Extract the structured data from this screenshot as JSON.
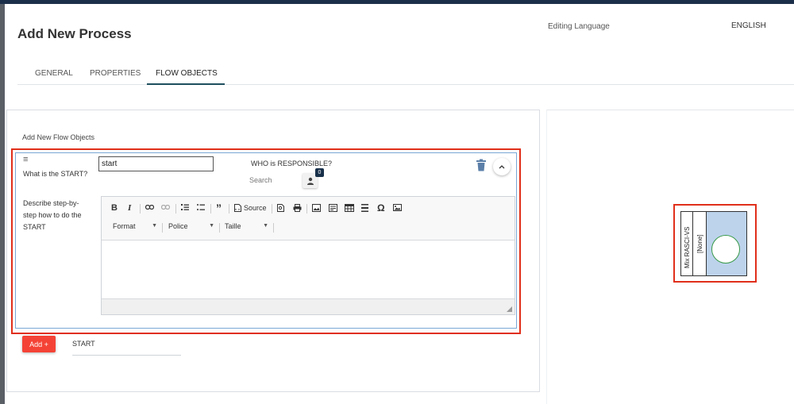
{
  "page": {
    "title": "Add New Process"
  },
  "language": {
    "label": "Editing Language",
    "value": "ENGLISH"
  },
  "tabs": [
    {
      "label": "GENERAL",
      "active": false
    },
    {
      "label": "PROPERTIES",
      "active": false
    },
    {
      "label": "FLOW OBJECTS",
      "active": true
    }
  ],
  "section": {
    "title": "Add New Flow Objects"
  },
  "flow_object": {
    "question_label": "What is the START?",
    "input_value": "start",
    "responsible_label": "WHO is RESPONSIBLE?",
    "search_placeholder": "Search",
    "responsible_count": "0",
    "describe_label": "Describe step-by-step how to do the START",
    "collapse_icon": "chevron-up-icon",
    "delete_icon": "trash-icon"
  },
  "editor": {
    "source_label": "Source",
    "format_label": "Format",
    "font_label": "Police",
    "size_label": "Taille"
  },
  "add": {
    "button_label": "Add +",
    "field_value": "START"
  },
  "diagram": {
    "lane_label_1": "Mix RASCI-VS",
    "lane_label_2": "[None]"
  },
  "colors": {
    "highlight": "#e02f1a",
    "add_button": "#f44336",
    "lane_fill": "#bdd3ec",
    "start_event_stroke": "#3a9a4a",
    "tab_accent": "#1e4f5e"
  }
}
